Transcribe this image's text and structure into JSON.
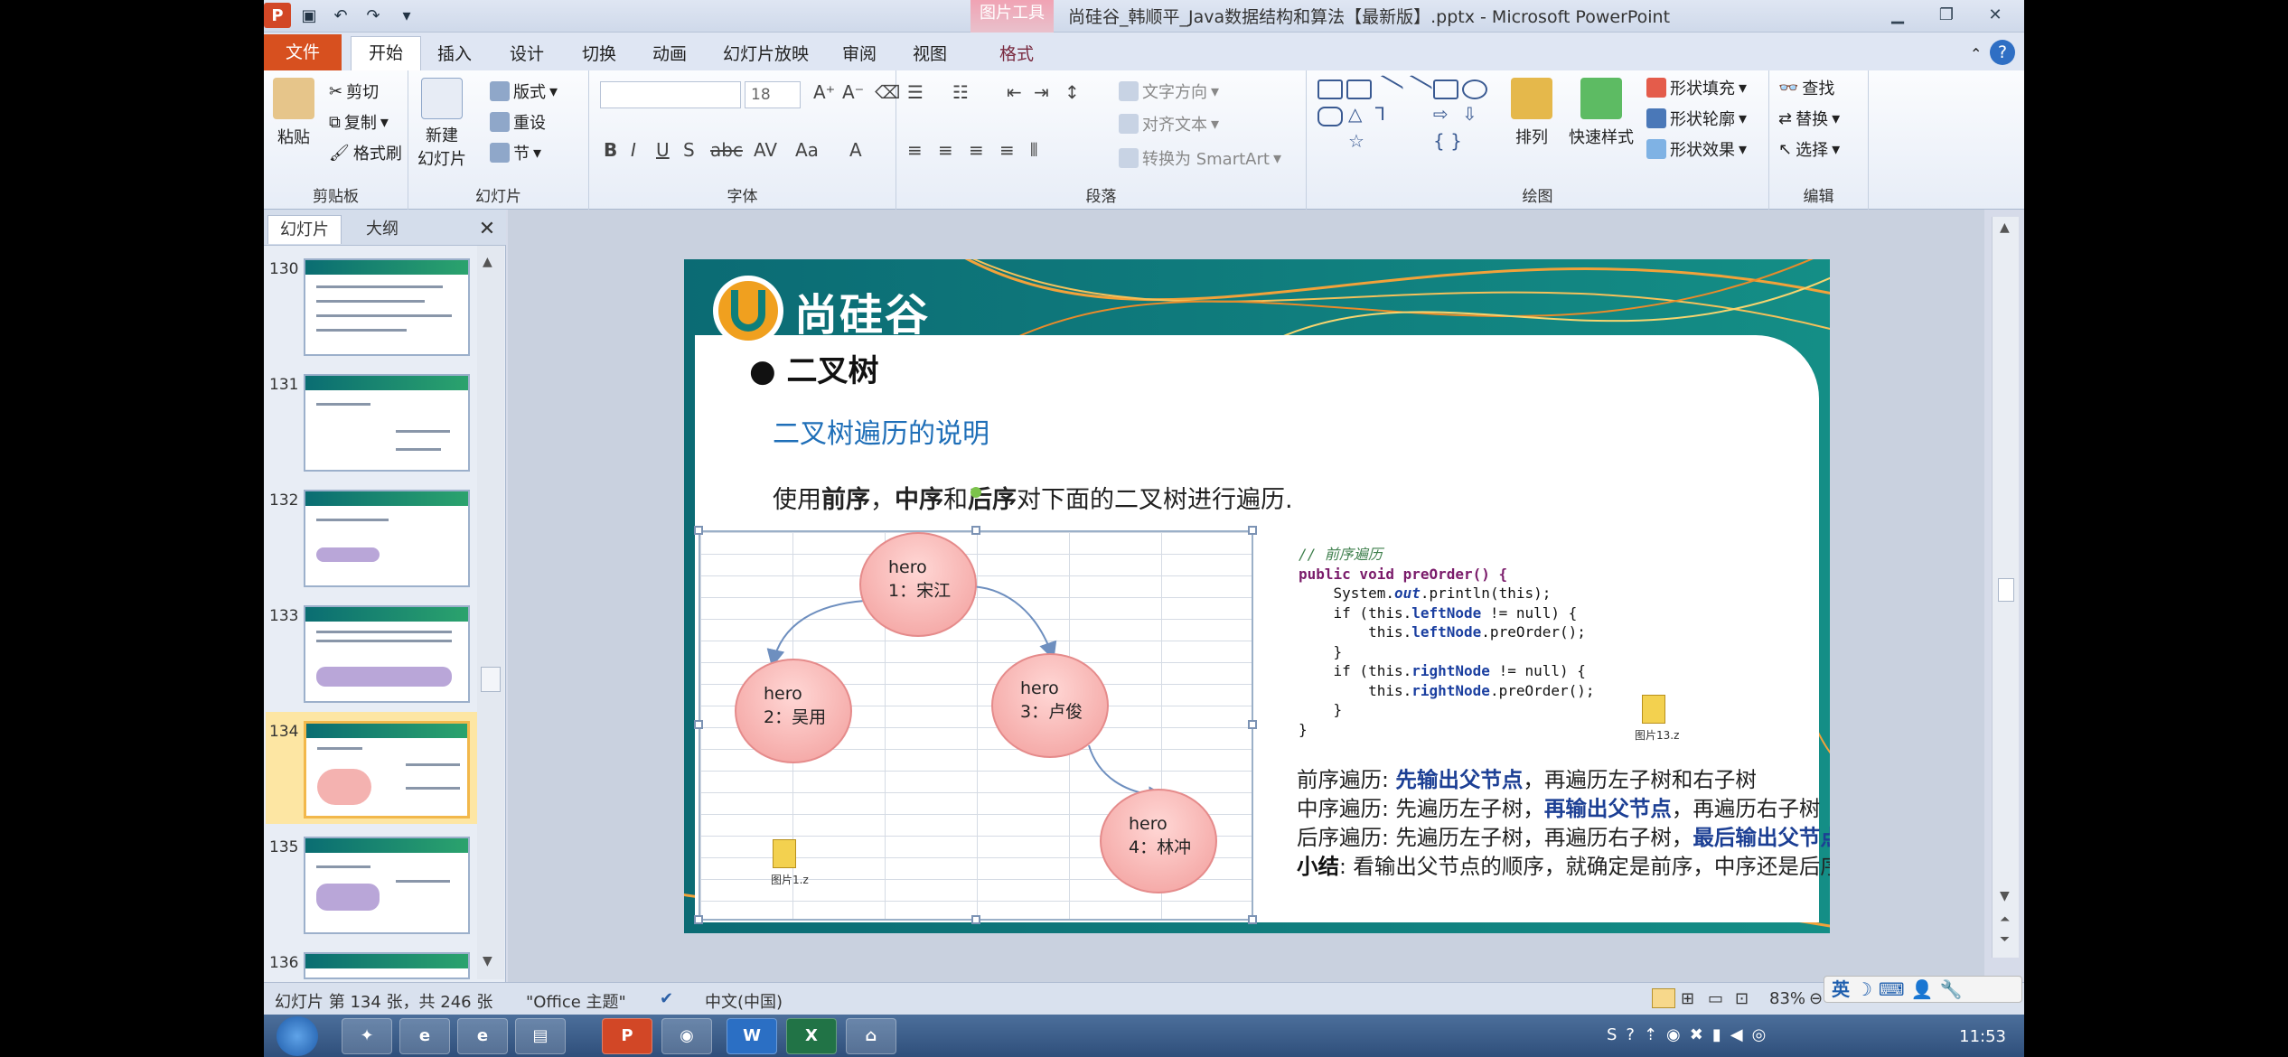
{
  "window": {
    "title": "尚硅谷_韩顺平_Java数据结构和算法【最新版】.pptx - Microsoft PowerPoint",
    "context_tab": "图片工具",
    "app_logo": "P"
  },
  "tabs": [
    "文件",
    "开始",
    "插入",
    "设计",
    "切换",
    "动画",
    "幻灯片放映",
    "审阅",
    "视图",
    "格式"
  ],
  "ribbon": {
    "clipboard": {
      "label": "剪贴板",
      "paste": "粘贴",
      "cut": "剪切",
      "copy": "复制",
      "format_painter": "格式刷"
    },
    "slides": {
      "label": "幻灯片",
      "new_slide_line1": "新建",
      "new_slide_line2": "幻灯片",
      "layout": "版式",
      "reset": "重设",
      "section": "节"
    },
    "font": {
      "label": "字体",
      "font_name": "",
      "font_size": "18"
    },
    "paragraph": {
      "label": "段落",
      "text_direction": "文字方向",
      "align_text": "对齐文本",
      "smartart": "转换为 SmartArt"
    },
    "drawing": {
      "label": "绘图",
      "arrange": "排列",
      "quick_styles": "快速样式",
      "shape_fill": "形状填充",
      "shape_outline": "形状轮廓",
      "shape_effects": "形状效果"
    },
    "editing": {
      "label": "编辑",
      "find": "查找",
      "replace": "替换",
      "select": "选择"
    }
  },
  "left_pane": {
    "tab_slides": "幻灯片",
    "tab_outline": "大纲",
    "slide_numbers": [
      "130",
      "131",
      "132",
      "133",
      "134",
      "135",
      "136"
    ],
    "selected": "134"
  },
  "slide": {
    "logo_text": "尚硅谷",
    "bullet_title": "二叉树",
    "subtitle": "二叉树遍历的说明",
    "intro_prefix": "使用",
    "intro_b1": "前序",
    "intro_sep": "，",
    "intro_b2": "中序",
    "intro_and": "和",
    "intro_b3": "后序",
    "intro_suffix": "对下面的二叉树进行遍历.",
    "nodes": [
      {
        "line1": "hero",
        "line2": "1：宋江"
      },
      {
        "line1": "hero",
        "line2": "2：吴用"
      },
      {
        "line1": "hero",
        "line2": "3：卢俊"
      },
      {
        "line1": "hero",
        "line2": "4：林冲"
      }
    ],
    "image_caption_1": "图片1.z",
    "image_caption_2": "图片13.z",
    "code": {
      "comment": "// 前序遍历",
      "l1": "public void preOrder() {",
      "l2a": "    System.",
      "l2b": "out",
      "l2c": ".println(this);",
      "l3a": "    if (this.",
      "l3b": "leftNode",
      "l3c": " != null) {",
      "l4a": "        this.",
      "l4b": "leftNode",
      "l4c": ".preOrder();",
      "l5": "    }",
      "l6a": "    if (this.",
      "l6b": "rightNode",
      "l6c": " != null) {",
      "l7a": "        this.",
      "l7b": "rightNode",
      "l7c": ".preOrder();",
      "l8": "    }",
      "l9": "}"
    },
    "summary": {
      "pre_label": "前序遍历: ",
      "pre_bold": "先输出父节点",
      "pre_rest": "，再遍历左子树和右子树",
      "in_label": "中序遍历: 先遍历左子树，",
      "in_bold": "再输出父节点",
      "in_rest": "，再遍历右子树",
      "post_label": "后序遍历: 先遍历左子树，再遍历右子树，",
      "post_bold": "最后输出父节点",
      "sum_label": "小结",
      "sum_rest": ": 看输出父节点的顺序，就确定是前序，中序还是后序"
    }
  },
  "status": {
    "slide_info": "幻灯片 第 134 张，共 246 张",
    "theme": "\"Office 主题\"",
    "language": "中文(中国)",
    "zoom": "83%"
  },
  "ime": {
    "label": "英"
  },
  "taskbar": {
    "clock": "11:53"
  },
  "colors": {
    "file_tab": "#d7501f",
    "slide_teal": "#0f7c7b",
    "accent_blue": "#1f6fb8",
    "node_fill": "#f29d9b",
    "selection": "#f2b84b"
  }
}
